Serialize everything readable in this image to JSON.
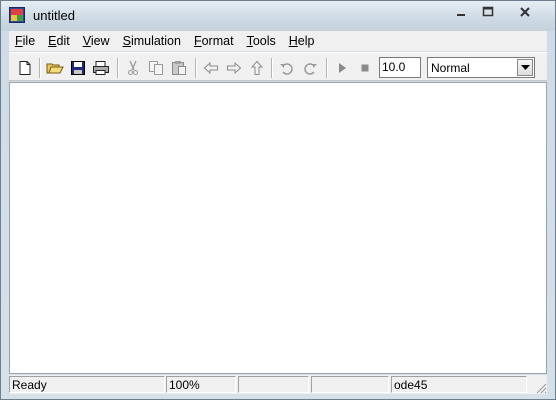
{
  "window": {
    "title": "untitled"
  },
  "titlebar_buttons": [
    "minimize-icon",
    "maximize-icon",
    "close-icon"
  ],
  "menu": [
    {
      "label": "File",
      "mnemonic": "F",
      "rest": "ile"
    },
    {
      "label": "Edit",
      "mnemonic": "E",
      "rest": "dit"
    },
    {
      "label": "View",
      "mnemonic": "V",
      "rest": "iew"
    },
    {
      "label": "Simulation",
      "mnemonic": "S",
      "rest": "imulation"
    },
    {
      "label": "Format",
      "mnemonic": "F",
      "rest": "ormat"
    },
    {
      "label": "Tools",
      "mnemonic": "T",
      "rest": "ools"
    },
    {
      "label": "Help",
      "mnemonic": "H",
      "rest": "elp"
    }
  ],
  "toolbar": {
    "icons": [
      "new-file-icon",
      "open-folder-icon",
      "save-icon",
      "print-icon",
      "cut-icon",
      "copy-icon",
      "paste-icon",
      "back-arrow-icon",
      "forward-arrow-icon",
      "up-arrow-icon",
      "undo-icon",
      "redo-icon",
      "play-icon",
      "stop-icon"
    ],
    "stop_time": "10.0",
    "sim_mode": "Normal"
  },
  "status": {
    "state": "Ready",
    "zoom": "100%",
    "cell3": "",
    "cell4": "",
    "solver": "ode45"
  }
}
